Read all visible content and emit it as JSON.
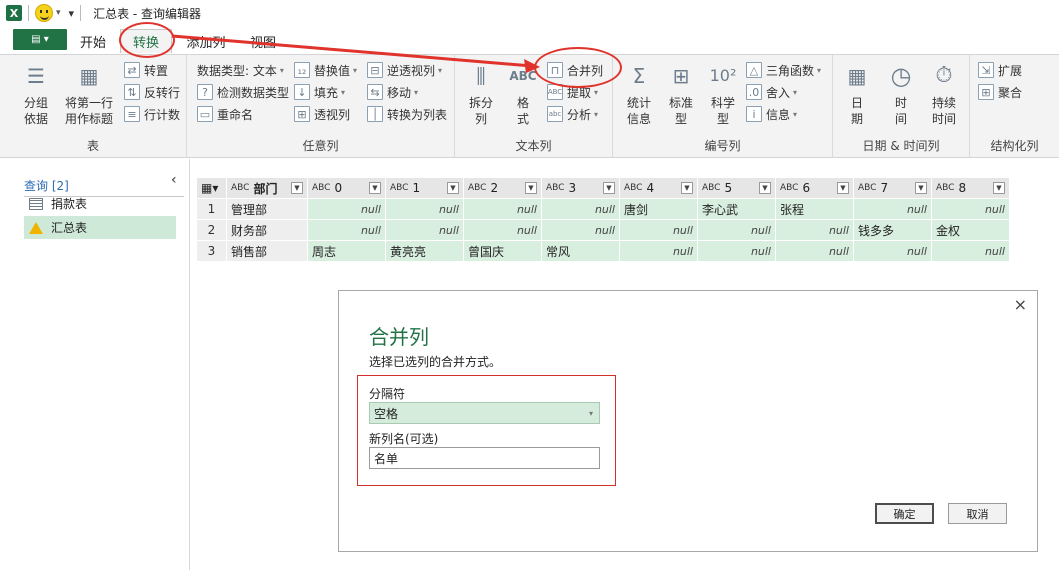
{
  "window": {
    "app_icon": "excel-icon",
    "title": "汇总表 - 查询编辑器",
    "quick_access_more": "▾"
  },
  "tabs": [
    {
      "label": "开始"
    },
    {
      "label": "转换"
    },
    {
      "label": "添加列"
    },
    {
      "label": "视图"
    }
  ],
  "ribbon": {
    "groups": {
      "table": {
        "label": "表",
        "group_by": "分组\n依据",
        "first_row_header": "将第一行\n用作标题",
        "transpose": "转置",
        "reverse_rows": "反转行",
        "count_rows": "行计数"
      },
      "any_column": {
        "label": "任意列",
        "data_type": "数据类型: 文本",
        "detect_type": "检测数据类型",
        "rename": "重命名",
        "replace_values": "替换值",
        "fill": "填充",
        "pivot": "透视列",
        "unpivot": "逆透视列",
        "move": "移动",
        "to_list": "转换为列表"
      },
      "text_column": {
        "label": "文本列",
        "split": "拆分\n列",
        "format": "格\n式",
        "merge": "合并列",
        "extract": "提取",
        "parse": "分析"
      },
      "number_column": {
        "label": "编号列",
        "statistics": "统计\n信息",
        "standard": "标准\n型",
        "scientific": "科学\n型",
        "trig": "三角函数",
        "round": "舍入",
        "info": "信息"
      },
      "datetime_column": {
        "label": "日期 & 时间列",
        "date": "日\n期",
        "time": "时\n间",
        "duration": "持续\n时间"
      },
      "structured_column": {
        "label": "结构化列",
        "expand": "扩展",
        "aggregate": "聚合"
      }
    }
  },
  "queries": {
    "header": "查询 [2]",
    "collapse_icon": "‹",
    "items": [
      {
        "name": "捐款表",
        "icon": "table-icon"
      },
      {
        "name": "汇总表",
        "icon": "warning-icon"
      }
    ]
  },
  "grid": {
    "columns": [
      {
        "type": "ABC",
        "name": "部门"
      },
      {
        "type": "ABC",
        "name": "0"
      },
      {
        "type": "ABC",
        "name": "1"
      },
      {
        "type": "ABC",
        "name": "2"
      },
      {
        "type": "ABC",
        "name": "3"
      },
      {
        "type": "ABC",
        "name": "4"
      },
      {
        "type": "ABC",
        "name": "5"
      },
      {
        "type": "ABC",
        "name": "6"
      },
      {
        "type": "ABC",
        "name": "7"
      },
      {
        "type": "ABC",
        "name": "8"
      }
    ],
    "rows": [
      {
        "n": "1",
        "cells": [
          "管理部",
          "null",
          "null",
          "null",
          "null",
          "唐剑",
          "李心武",
          "张程",
          "null",
          "null"
        ]
      },
      {
        "n": "2",
        "cells": [
          "财务部",
          "null",
          "null",
          "null",
          "null",
          "null",
          "null",
          "null",
          "钱多多",
          "金权"
        ]
      },
      {
        "n": "3",
        "cells": [
          "销售部",
          "周志",
          "黄亮亮",
          "曾国庆",
          "常风",
          "null",
          "null",
          "null",
          "null",
          "null"
        ]
      }
    ]
  },
  "dialog": {
    "title": "合并列",
    "description": "选择已选列的合并方式。",
    "separator_label": "分隔符",
    "separator_value": "空格",
    "new_column_label": "新列名(可选)",
    "new_column_value": "名单",
    "ok": "确定",
    "cancel": "取消",
    "close": "×"
  },
  "colors": {
    "excel_green": "#217346",
    "selection_green": "#d8eedf",
    "annotation_red": "#e0332c"
  }
}
